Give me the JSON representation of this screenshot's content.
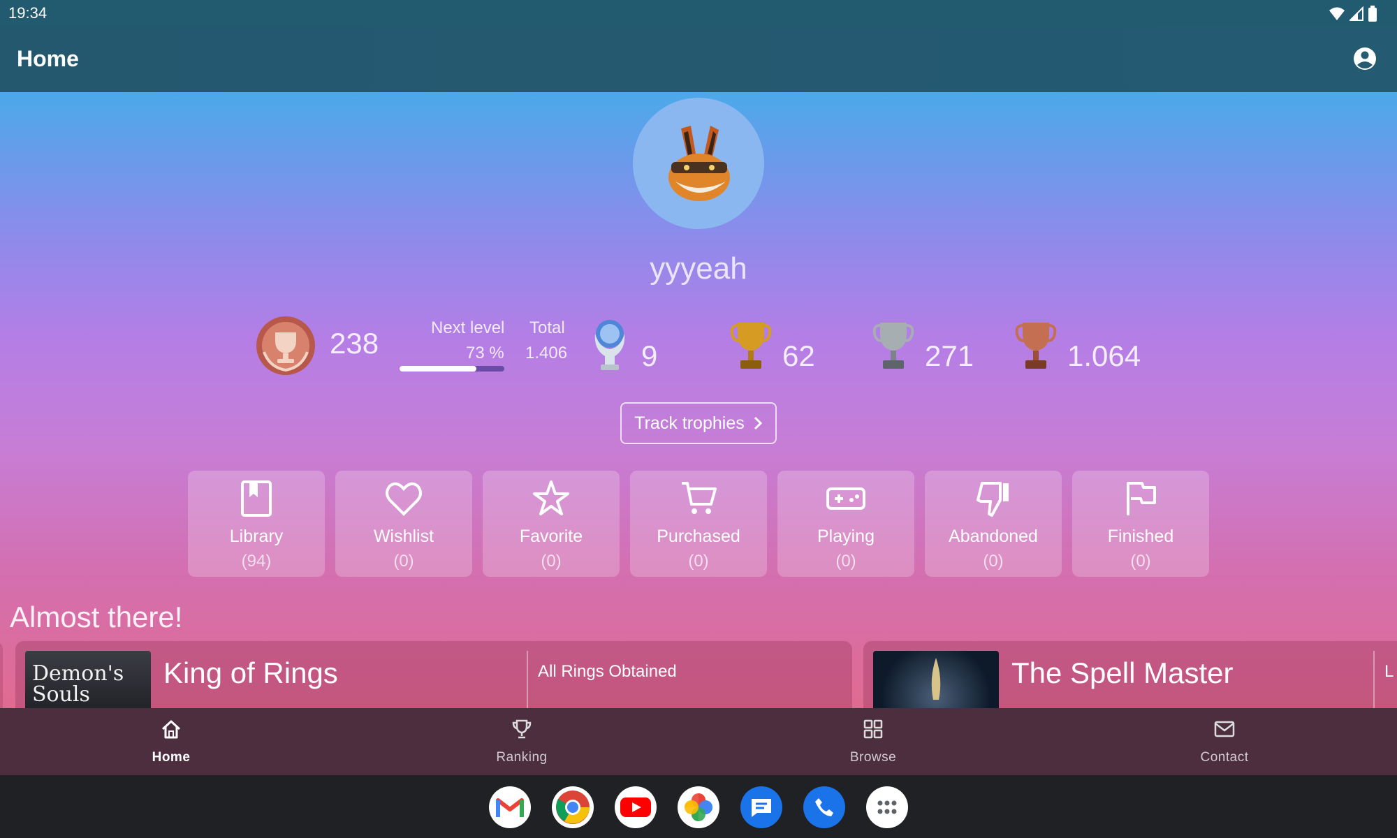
{
  "status_bar": {
    "time": "19:34"
  },
  "app_bar": {
    "title": "Home"
  },
  "profile": {
    "username": "yyyeah",
    "level": "238",
    "next_level_label": "Next level",
    "next_level_percent": "73 %",
    "next_level_progress": 0.73,
    "total_label": "Total",
    "total_value": "1.406",
    "trophies": {
      "platinum": "9",
      "gold": "62",
      "silver": "271",
      "bronze": "1.064"
    }
  },
  "track_button": {
    "label": "Track trophies"
  },
  "categories": [
    {
      "label": "Library",
      "count": "(94)",
      "icon": "bookmark-icon"
    },
    {
      "label": "Wishlist",
      "count": "(0)",
      "icon": "heart-icon"
    },
    {
      "label": "Favorite",
      "count": "(0)",
      "icon": "star-icon"
    },
    {
      "label": "Purchased",
      "count": "(0)",
      "icon": "cart-icon"
    },
    {
      "label": "Playing",
      "count": "(0)",
      "icon": "gamepad-icon"
    },
    {
      "label": "Abandoned",
      "count": "(0)",
      "icon": "thumbs-down-icon"
    },
    {
      "label": "Finished",
      "count": "(0)",
      "icon": "flag-icon"
    }
  ],
  "almost_there": {
    "title": "Almost there!",
    "cards": [
      {
        "title": "King of Rings",
        "description": "All Rings Obtained",
        "thumb_text": "Demon's Souls"
      },
      {
        "title": "The Spell Master",
        "description": "L"
      }
    ]
  },
  "bottom_nav": [
    {
      "label": "Home",
      "icon": "home-icon",
      "active": true
    },
    {
      "label": "Ranking",
      "icon": "trophy-icon",
      "active": false
    },
    {
      "label": "Browse",
      "icon": "grid-icon",
      "active": false
    },
    {
      "label": "Contact",
      "icon": "mail-icon",
      "active": false
    }
  ],
  "dock": [
    "gmail-icon",
    "chrome-icon",
    "youtube-icon",
    "photos-icon",
    "messages-icon",
    "phone-icon",
    "app-drawer-icon"
  ],
  "colors": {
    "app_bar": "#245a72",
    "gradient_top": "#4ba9ea",
    "gradient_mid": "#b47ee6",
    "gradient_bottom": "#e06b90",
    "gold": "#c9941e",
    "silver": "#9aa2a6",
    "bronze": "#c2684a"
  }
}
